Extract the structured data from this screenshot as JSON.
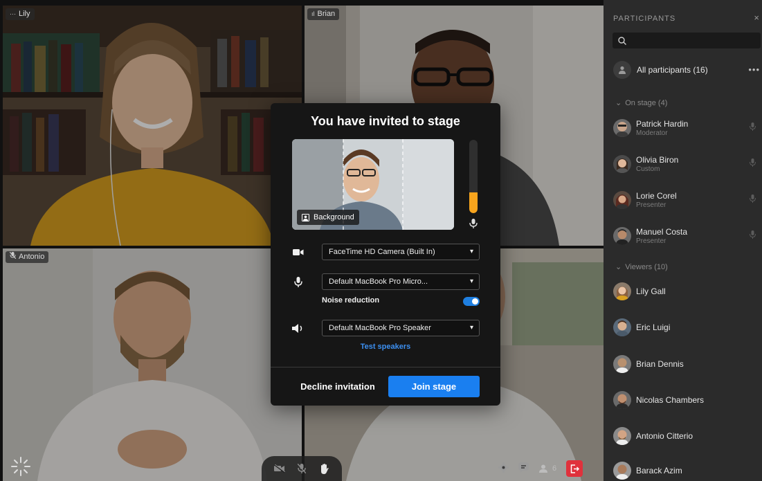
{
  "tiles": {
    "lily": {
      "name": "Lily",
      "status_icon": "ellipsis-icon"
    },
    "brian": {
      "name": "Brian",
      "status_icon": "audio-level-icon"
    },
    "antonio": {
      "name": "Antonio",
      "status_icon": "mic-muted-icon"
    }
  },
  "controls": {
    "participant_count": "6"
  },
  "sidebar": {
    "title": "PARTICIPANTS",
    "close": "×",
    "search_placeholder": "",
    "all_participants": "All participants (16)",
    "more": "•••",
    "on_stage_header": "On stage (4)",
    "viewers_header": "Viewers (10)",
    "on_stage": [
      {
        "name": "Patrick Hardin",
        "role": "Moderator"
      },
      {
        "name": "Olivia Biron",
        "role": "Custom"
      },
      {
        "name": "Lorie Corel",
        "role": "Presenter"
      },
      {
        "name": "Manuel Costa",
        "role": "Presenter"
      }
    ],
    "viewers": [
      {
        "name": "Lily Gall"
      },
      {
        "name": "Eric Luigi"
      },
      {
        "name": "Brian Dennis"
      },
      {
        "name": "Nicolas Chambers"
      },
      {
        "name": "Antonio Citterio"
      },
      {
        "name": "Barack Azim"
      }
    ]
  },
  "modal": {
    "title": "You have invited to stage",
    "background_label": "Background",
    "mic_level": 0.28,
    "camera": "FaceTime HD Camera (Built In)",
    "microphone": "Default MacBook Pro Micro...",
    "noise_reduction_label": "Noise reduction",
    "noise_reduction_on": true,
    "speaker": "Default MacBook Pro Speaker",
    "test_speakers": "Test speakers",
    "decline": "Decline invitation",
    "join": "Join stage"
  },
  "colors": {
    "accent": "#1a7ff0",
    "meter": "#f7a41d",
    "leave": "#e0313c"
  }
}
